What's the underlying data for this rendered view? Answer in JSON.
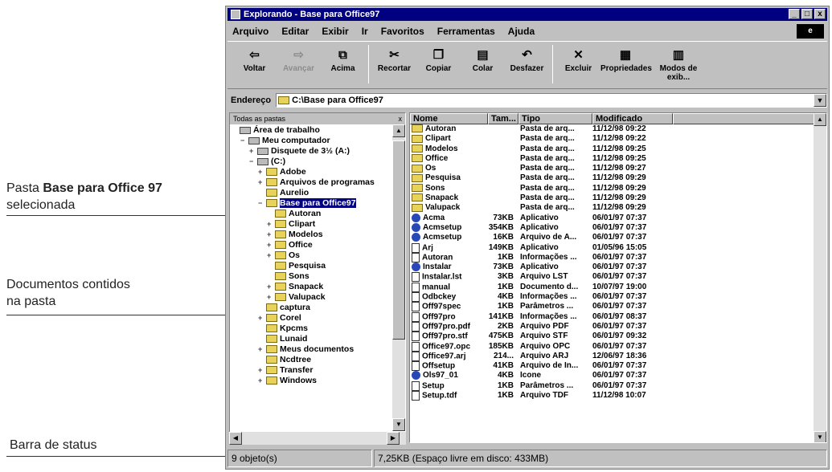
{
  "annotations": {
    "pasta_prefix": "Pasta ",
    "pasta_bold": "Base para Office 97",
    "pasta_suffix": "selecionada",
    "documentos_line1": "Documentos contidos",
    "documentos_line2": "na pasta",
    "barra": "Barra de status"
  },
  "window": {
    "title": "Explorando - Base para Office97",
    "btn_min": "_",
    "btn_max": "□",
    "btn_close": "x"
  },
  "menu": {
    "items": [
      "Arquivo",
      "Editar",
      "Exibir",
      "Ir",
      "Favoritos",
      "Ferramentas",
      "Ajuda"
    ]
  },
  "toolbar": {
    "voltar": "Voltar",
    "avancar": "Avançar",
    "acima": "Acima",
    "recortar": "Recortar",
    "copiar": "Copiar",
    "colar": "Colar",
    "desfazer": "Desfazer",
    "excluir": "Excluir",
    "propriedades": "Propriedades",
    "modos": "Modos de exib..."
  },
  "address": {
    "label": "Endereço",
    "value": "C:\\Base para Office97"
  },
  "tree": {
    "header": "Todas as pastas",
    "close": "x",
    "nodes": [
      {
        "label": "Área de trabalho",
        "indent": 0,
        "pm": "",
        "icon": "desktop"
      },
      {
        "label": "Meu computador",
        "indent": 1,
        "pm": "−",
        "icon": "computer"
      },
      {
        "label": "Disquete de 3½ (A:)",
        "indent": 2,
        "pm": "+",
        "icon": "drive"
      },
      {
        "label": "(C:)",
        "indent": 2,
        "pm": "−",
        "icon": "drive"
      },
      {
        "label": "Adobe",
        "indent": 3,
        "pm": "+",
        "icon": "folder"
      },
      {
        "label": "Arquivos de programas",
        "indent": 3,
        "pm": "+",
        "icon": "folder"
      },
      {
        "label": "Aurelio",
        "indent": 3,
        "pm": "",
        "icon": "folder"
      },
      {
        "label": "Base para Office97",
        "indent": 3,
        "pm": "−",
        "icon": "folder",
        "selected": true
      },
      {
        "label": "Autoran",
        "indent": 4,
        "pm": "",
        "icon": "folder"
      },
      {
        "label": "Clipart",
        "indent": 4,
        "pm": "+",
        "icon": "folder"
      },
      {
        "label": "Modelos",
        "indent": 4,
        "pm": "+",
        "icon": "folder"
      },
      {
        "label": "Office",
        "indent": 4,
        "pm": "+",
        "icon": "folder"
      },
      {
        "label": "Os",
        "indent": 4,
        "pm": "+",
        "icon": "folder"
      },
      {
        "label": "Pesquisa",
        "indent": 4,
        "pm": "",
        "icon": "folder"
      },
      {
        "label": "Sons",
        "indent": 4,
        "pm": "",
        "icon": "folder"
      },
      {
        "label": "Snapack",
        "indent": 4,
        "pm": "+",
        "icon": "folder"
      },
      {
        "label": "Valupack",
        "indent": 4,
        "pm": "+",
        "icon": "folder"
      },
      {
        "label": "captura",
        "indent": 3,
        "pm": "",
        "icon": "folder"
      },
      {
        "label": "Corel",
        "indent": 3,
        "pm": "+",
        "icon": "folder"
      },
      {
        "label": "Kpcms",
        "indent": 3,
        "pm": "",
        "icon": "folder"
      },
      {
        "label": "Lunaid",
        "indent": 3,
        "pm": "",
        "icon": "folder"
      },
      {
        "label": "Meus documentos",
        "indent": 3,
        "pm": "+",
        "icon": "folder"
      },
      {
        "label": "Ncdtree",
        "indent": 3,
        "pm": "",
        "icon": "folder"
      },
      {
        "label": "Transfer",
        "indent": 3,
        "pm": "+",
        "icon": "folder"
      },
      {
        "label": "Windows",
        "indent": 3,
        "pm": "+",
        "icon": "folder"
      }
    ]
  },
  "list": {
    "headers": [
      "Nome",
      "Tam...",
      "Tipo",
      "Modificado"
    ],
    "rows": [
      {
        "name": "Autoran",
        "size": "",
        "type": "Pasta de arq...",
        "mod": "11/12/98 09:22",
        "icon": "folder"
      },
      {
        "name": "Clipart",
        "size": "",
        "type": "Pasta de arq...",
        "mod": "11/12/98 09:22",
        "icon": "folder"
      },
      {
        "name": "Modelos",
        "size": "",
        "type": "Pasta de arq...",
        "mod": "11/12/98 09:25",
        "icon": "folder"
      },
      {
        "name": "Office",
        "size": "",
        "type": "Pasta de arq...",
        "mod": "11/12/98 09:25",
        "icon": "folder"
      },
      {
        "name": "Os",
        "size": "",
        "type": "Pasta de arq...",
        "mod": "11/12/98 09:27",
        "icon": "folder"
      },
      {
        "name": "Pesquisa",
        "size": "",
        "type": "Pasta de arq...",
        "mod": "11/12/98 09:29",
        "icon": "folder"
      },
      {
        "name": "Sons",
        "size": "",
        "type": "Pasta de arq...",
        "mod": "11/12/98 09:29",
        "icon": "folder"
      },
      {
        "name": "Snapack",
        "size": "",
        "type": "Pasta de arq...",
        "mod": "11/12/98 09:29",
        "icon": "folder"
      },
      {
        "name": "Valupack",
        "size": "",
        "type": "Pasta de arq...",
        "mod": "11/12/98 09:29",
        "icon": "folder"
      },
      {
        "name": "Acma",
        "size": "73KB",
        "type": "Aplicativo",
        "mod": "06/01/97 07:37",
        "icon": "app"
      },
      {
        "name": "Acmsetup",
        "size": "354KB",
        "type": "Aplicativo",
        "mod": "06/01/97 07:37",
        "icon": "app"
      },
      {
        "name": "Acmsetup",
        "size": "16KB",
        "type": "Arquivo de A...",
        "mod": "06/01/97 07:37",
        "icon": "app"
      },
      {
        "name": "Arj",
        "size": "149KB",
        "type": "Aplicativo",
        "mod": "01/05/96 15:05",
        "icon": "doc"
      },
      {
        "name": "Autoran",
        "size": "1KB",
        "type": "Informações ...",
        "mod": "06/01/97 07:37",
        "icon": "doc"
      },
      {
        "name": "Instalar",
        "size": "73KB",
        "type": "Aplicativo",
        "mod": "06/01/97 07:37",
        "icon": "app"
      },
      {
        "name": "Instalar.lst",
        "size": "3KB",
        "type": "Arquivo LST",
        "mod": "06/01/97 07:37",
        "icon": "doc"
      },
      {
        "name": "manual",
        "size": "1KB",
        "type": "Documento d...",
        "mod": "10/07/97 19:00",
        "icon": "doc"
      },
      {
        "name": "Odbckey",
        "size": "4KB",
        "type": "Informações ...",
        "mod": "06/01/97 07:37",
        "icon": "doc"
      },
      {
        "name": "Off97spec",
        "size": "1KB",
        "type": "Parâmetros ...",
        "mod": "06/01/97 07:37",
        "icon": "doc"
      },
      {
        "name": "Off97pro",
        "size": "141KB",
        "type": "Informações ...",
        "mod": "06/01/97 08:37",
        "icon": "doc"
      },
      {
        "name": "Off97pro.pdf",
        "size": "2KB",
        "type": "Arquivo PDF",
        "mod": "06/01/97 07:37",
        "icon": "doc"
      },
      {
        "name": "Off97pro.stf",
        "size": "475KB",
        "type": "Arquivo STF",
        "mod": "06/01/97 09:32",
        "icon": "doc"
      },
      {
        "name": "Office97.opc",
        "size": "185KB",
        "type": "Arquivo OPC",
        "mod": "06/01/97 07:37",
        "icon": "doc"
      },
      {
        "name": "Office97.arj",
        "size": "214...",
        "type": "Arquivo ARJ",
        "mod": "12/06/97 18:36",
        "icon": "doc"
      },
      {
        "name": "Offsetup",
        "size": "41KB",
        "type": "Arquivo de In...",
        "mod": "06/01/97 07:37",
        "icon": "doc"
      },
      {
        "name": "Ols97_01",
        "size": "4KB",
        "type": "Ícone",
        "mod": "06/01/97 07:37",
        "icon": "app"
      },
      {
        "name": "Setup",
        "size": "1KB",
        "type": "Parâmetros ...",
        "mod": "06/01/97 07:37",
        "icon": "doc"
      },
      {
        "name": "Setup.tdf",
        "size": "1KB",
        "type": "Arquivo TDF",
        "mod": "11/12/98 10:07",
        "icon": "doc"
      }
    ]
  },
  "status": {
    "objects": "9 objeto(s)",
    "info": "7,25KB (Espaço livre em disco: 433MB)"
  }
}
